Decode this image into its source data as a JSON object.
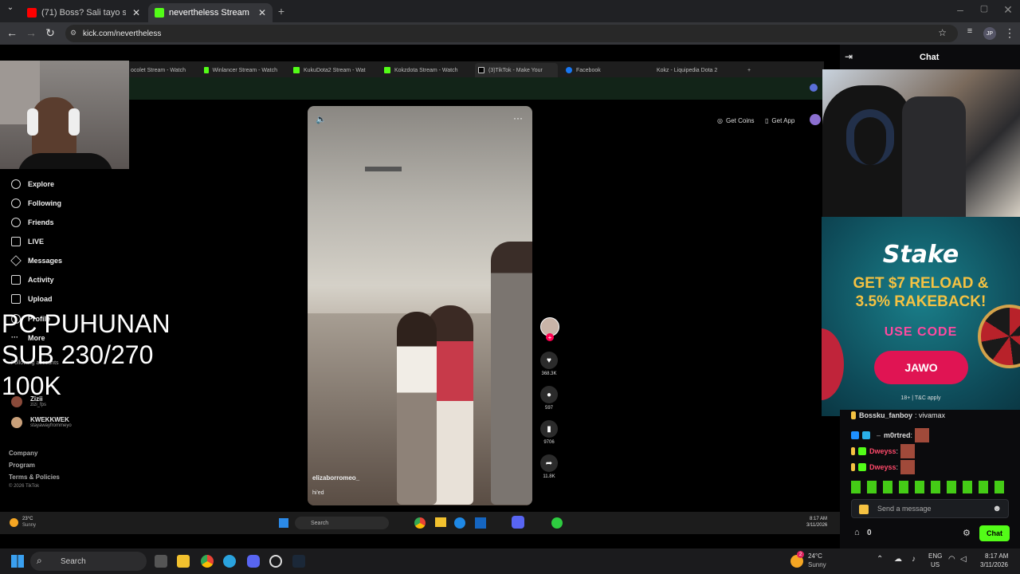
{
  "browser": {
    "tabs": [
      {
        "title": "(71) Boss? Sali tayo sa pinoy he",
        "active": false
      },
      {
        "title": "nevertheless Stream - Watch Li",
        "active": true
      }
    ],
    "url": "kick.com/nevertheless",
    "new_tab": "+"
  },
  "inner_browser": {
    "tabs": [
      "ocolet Stream - Watch",
      "Winlancer Stream - Watch",
      "KukuDota2 Stream - Wat",
      "Kokzdota Stream - Watch",
      "(3)TikTok - Make Your",
      "Facebook",
      "Kokz - Liquipedia Dota 2"
    ],
    "buttons": {
      "coins": "Get Coins",
      "app": "Get App"
    }
  },
  "tiktok_sidebar": {
    "items": [
      "Explore",
      "Following",
      "Friends",
      "LIVE",
      "Messages",
      "Activity",
      "Upload",
      "Profile",
      "More"
    ],
    "following_header": "Following accounts",
    "accounts": [
      {
        "name": "Zizii",
        "handle": "zizi_fps"
      },
      {
        "name": "KWEKKWEK",
        "handle": "stayawayfrommeyo"
      }
    ],
    "footer": [
      "Company",
      "Program",
      "Terms & Policies",
      "© 2026 TikTok"
    ]
  },
  "overlay": {
    "line1": "PC PUHUNAN",
    "line2": "SUB 230/270",
    "line3": "100K"
  },
  "video": {
    "author": "elizaborromeo_",
    "caption": "hi'ed",
    "likes": "368.3K",
    "comments": "597",
    "saves": "9706",
    "shares": "11.8K"
  },
  "inner_taskbar": {
    "weather_temp": "23°C",
    "weather_desc": "Sunny",
    "search": "Search",
    "time": "8:17 AM",
    "date": "3/11/2026"
  },
  "chat": {
    "title": "Chat",
    "messages": [
      {
        "user": "Bossku_fanboy",
        "text": "vivamax",
        "color": "#e8e8e8"
      },
      {
        "user": "m0rtred",
        "text": "",
        "color": "#e8e8e8"
      },
      {
        "user": "Dweyss",
        "text": "",
        "color": "#ff4a6a"
      },
      {
        "user": "Dweyss",
        "text": "",
        "color": "#ff4a6a"
      }
    ],
    "input_placeholder": "Send a message",
    "points": "0",
    "send_button": "Chat"
  },
  "stake": {
    "brand": "Stake",
    "line1": "GET $7 RELOAD &",
    "line2": "3.5% RAKEBACK!",
    "use_code": "USE CODE",
    "code": "JAWO",
    "disclaimer": "18+ | T&C apply"
  },
  "taskbar": {
    "search": "Search",
    "weather_temp": "24°C",
    "weather_desc": "Sunny",
    "lang": "ENG",
    "region": "US",
    "time": "8:17 AM",
    "date": "3/11/2026",
    "badge": "2"
  },
  "colors": {
    "kick_green": "#53fc18",
    "accent_red": "#ff0050"
  }
}
